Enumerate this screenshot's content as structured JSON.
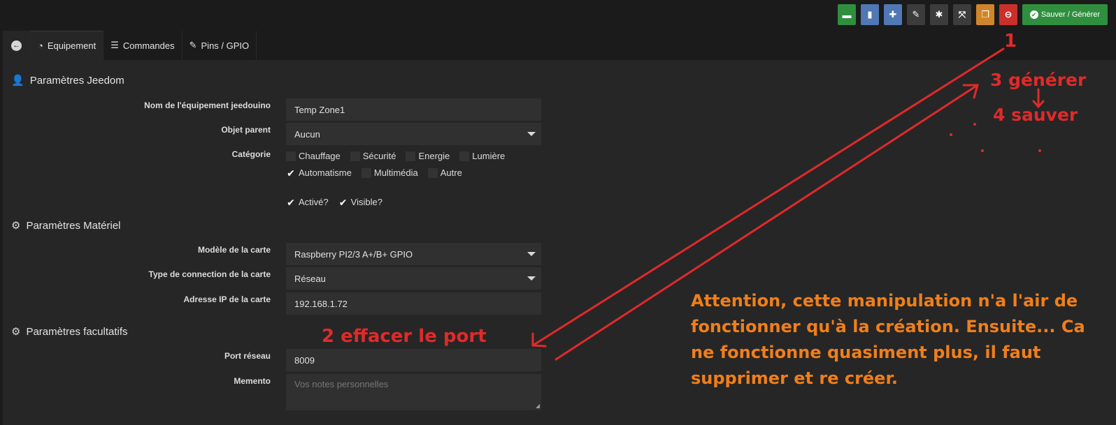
{
  "toolbar": {
    "buttons": [
      {
        "name": "book",
        "color": "#2f8f3f",
        "icon": "book-icon"
      },
      {
        "name": "file",
        "color": "#4f78b4",
        "icon": "file-icon"
      },
      {
        "name": "medkit",
        "color": "#4f78b4",
        "icon": "medkit-icon"
      },
      {
        "name": "wrench",
        "color": "#3c3c3c",
        "icon": "wrench-icon"
      },
      {
        "name": "cogs",
        "color": "#3c3c3c",
        "icon": "cogs-icon"
      },
      {
        "name": "expand",
        "color": "#3c3c3c",
        "icon": "expand-icon"
      },
      {
        "name": "copy",
        "color": "#d1852b",
        "icon": "copy-icon"
      },
      {
        "name": "remove",
        "color": "#c9302c",
        "icon": "minus-circle-icon"
      }
    ],
    "save_label": "Sauver / Générer"
  },
  "tabs": {
    "equipement": "Equipement",
    "commandes": "Commandes",
    "pins": "Pins / GPIO"
  },
  "sections": {
    "jeedom": "Paramètres Jeedom",
    "materiel": "Paramètres Matériel",
    "facultatifs": "Paramètres facultatifs"
  },
  "form": {
    "nom_label": "Nom de l'équipement jeedouino",
    "nom_value": "Temp Zone1",
    "objet_label": "Objet parent",
    "objet_value": "Aucun",
    "categorie_label": "Catégorie",
    "categories_row1": [
      {
        "label": "Chauffage",
        "checked": false
      },
      {
        "label": "Sécurité",
        "checked": false
      },
      {
        "label": "Energie",
        "checked": false
      },
      {
        "label": "Lumière",
        "checked": false
      }
    ],
    "categories_row2": [
      {
        "label": "Automatisme",
        "checked": true
      },
      {
        "label": "Multimédia",
        "checked": false
      },
      {
        "label": "Autre",
        "checked": false
      }
    ],
    "active_label": "Activé?",
    "visible_label": "Visible?",
    "modele_label": "Modèle de la carte",
    "modele_value": "Raspberry PI2/3 A+/B+ GPIO",
    "type_label": "Type de connection de la carte",
    "type_value": "Réseau",
    "ip_label": "Adresse IP de la carte",
    "ip_value": "192.168.1.72",
    "port_label": "Port réseau",
    "port_value": "8009",
    "memento_label": "Memento",
    "memento_placeholder": "Vos notes personnelles"
  },
  "annotations": {
    "step1": "1",
    "step2": "2 effacer le port",
    "step3": "3 générer",
    "step4": "4 sauver",
    "note": "Attention, cette manipulation n'a l'air de fonctionner qu'à la création. Ensuite... Ca ne fonctionne quasiment plus, il faut supprimer et re créer."
  }
}
